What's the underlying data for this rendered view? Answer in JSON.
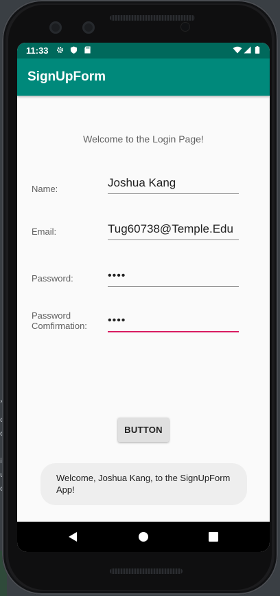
{
  "status_bar": {
    "time": "11:33",
    "left_icons": [
      "gear-icon",
      "shield-icon",
      "sd-card-icon"
    ],
    "right_icons": [
      "wifi-icon",
      "signal-icon",
      "battery-icon"
    ],
    "color": "#00695c"
  },
  "app_bar": {
    "title": "SignUpForm",
    "color": "#00897b"
  },
  "form": {
    "welcome_text": "Welcome to the Login Page!",
    "name_label": "Name:",
    "name_value": "Joshua Kang",
    "email_label": "Email:",
    "email_value": "Tug60738@Temple.Edu",
    "password_label": "Password:",
    "password_value": "••••",
    "confirm_label_line1": "Password",
    "confirm_label_line2": "Comfirmation:",
    "confirm_value": "••••",
    "focus_color": "#d81b60"
  },
  "button": {
    "label": "BUTTON"
  },
  "toast": {
    "message": "Welcome, Joshua Kang, to the SignUpForm App!"
  },
  "nav_bar": {
    "icons": [
      "back-icon",
      "home-icon",
      "recents-icon"
    ]
  }
}
